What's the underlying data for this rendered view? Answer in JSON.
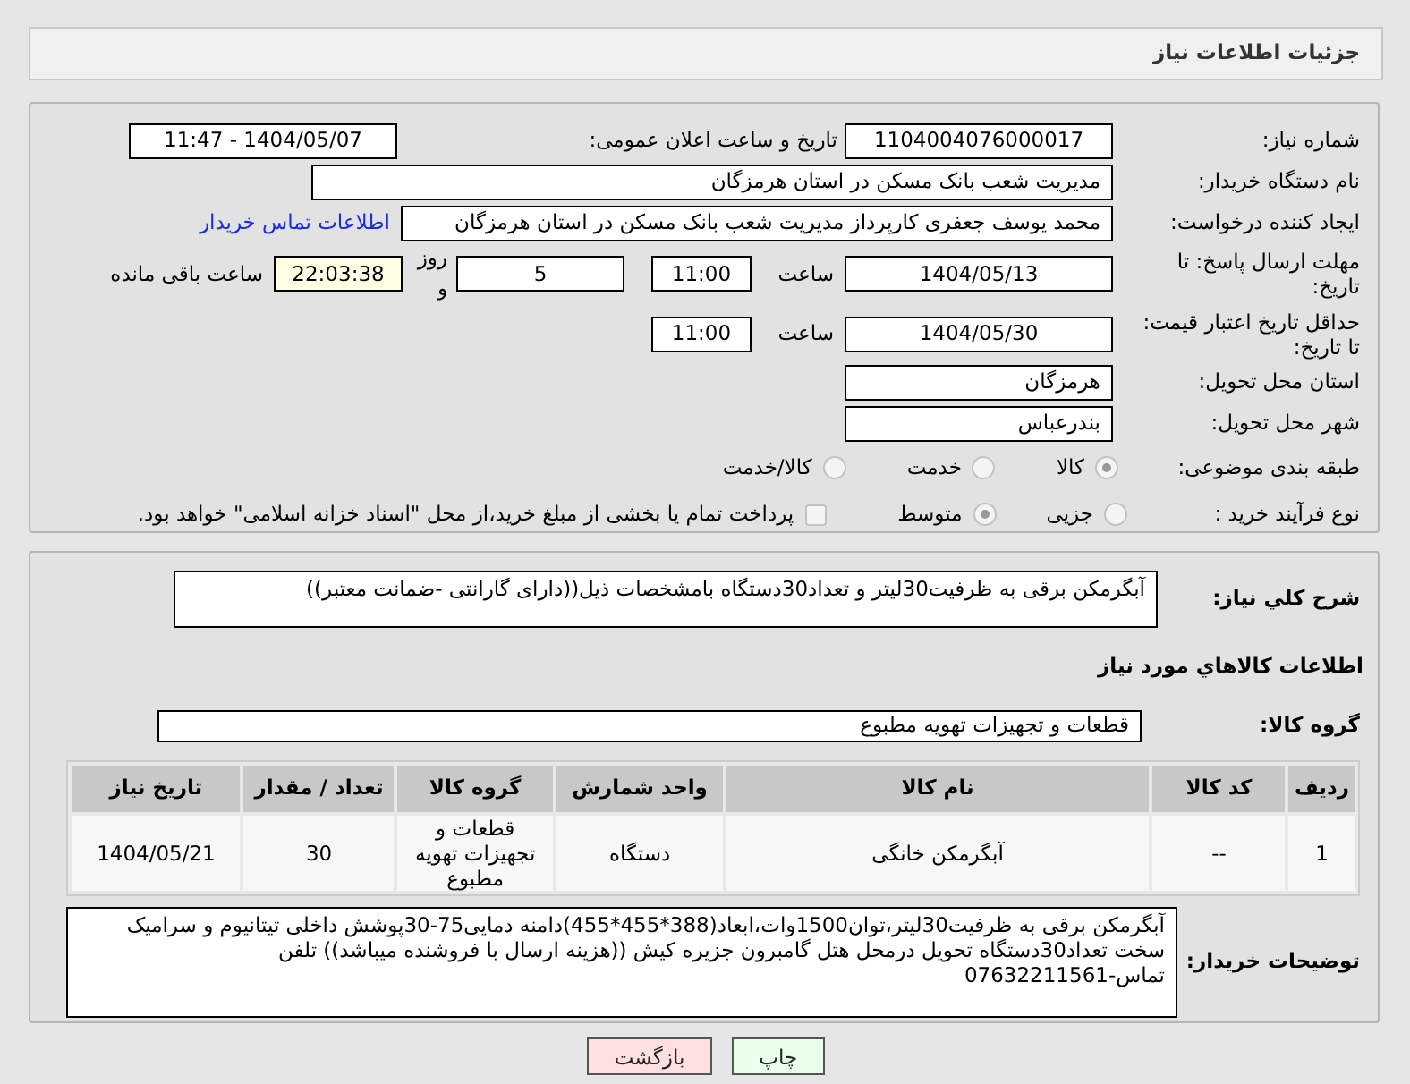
{
  "header": {
    "title": "جزئیات اطلاعات نیاز"
  },
  "need_number": {
    "label": "شماره نیاز:",
    "value": "1104004076000017"
  },
  "announce": {
    "label": "تاریخ و ساعت اعلان عمومی:",
    "value": "1404/05/07 - 11:47"
  },
  "buyer": {
    "label": "نام دستگاه خریدار:",
    "value": "مدیریت شعب بانک مسکن در استان هرمزگان"
  },
  "requester": {
    "label": "ایجاد کننده درخواست:",
    "value": "محمد  یوسف جعفری کارپرداز مدیریت شعب بانک مسکن در استان هرمزگان",
    "link": "اطلاعات تماس خریدار"
  },
  "reply_deadline": {
    "label": "مهلت ارسال پاسخ: تا تاریخ:",
    "date": "1404/05/13",
    "time_label": "ساعت",
    "time": "11:00",
    "days": "5",
    "days_label": "روز و",
    "remaining": "22:03:38",
    "remaining_label": "ساعت باقی مانده"
  },
  "price_validity": {
    "label": "حداقل تاریخ اعتبار قیمت: تا تاریخ:",
    "date": "1404/05/30",
    "time_label": "ساعت",
    "time": "11:00"
  },
  "province": {
    "label": "استان محل تحویل:",
    "value": "هرمزگان"
  },
  "city": {
    "label": "شهر محل تحویل:",
    "value": "بندرعباس"
  },
  "category": {
    "label": "طبقه بندی موضوعی:",
    "options": [
      {
        "label": "کالا",
        "selected": true
      },
      {
        "label": "خدمت",
        "selected": false
      },
      {
        "label": "کالا/خدمت",
        "selected": false
      }
    ]
  },
  "process": {
    "label": "نوع فرآیند خرید :",
    "options": [
      {
        "label": "جزیی",
        "selected": false
      },
      {
        "label": "متوسط",
        "selected": true
      }
    ],
    "payment": {
      "label": "پرداخت تمام یا بخشی از مبلغ خرید،از محل \"اسناد خزانه اسلامی\" خواهد بود.",
      "checked": false
    }
  },
  "description": {
    "label": "شرح کلي نياز:",
    "value": "آبگرمکن برقی به ظرفیت30لیتر و تعداد30دستگاه بامشخصات ذیل((دارای گارانتی -ضمانت معتبر))"
  },
  "goods_title": "اطلاعات کالاهاي مورد نياز",
  "goods_group": {
    "label": "گروه کالا:",
    "value": "قطعات و تجهیزات تهویه مطبوع"
  },
  "table": {
    "columns": [
      "ردیف",
      "کد کالا",
      "نام کالا",
      "واحد شمارش",
      "گروه کالا",
      "تعداد / مقدار",
      "تاریخ نیاز"
    ],
    "rows": [
      [
        "1",
        "--",
        "آبگرمکن خانگی",
        "دستگاه",
        "قطعات و تجهیزات تهویه مطبوع",
        "30",
        "1404/05/21"
      ]
    ]
  },
  "buyer_notes": {
    "label": "توضیحات خریدار:",
    "value": "آبگرمکن برقی به ظرفیت30لیتر،توان1500وات،ابعاد(388*455*455)دامنه دمایی75-30پوشش داخلی تیتانیوم و سرامیک سخت تعداد30دستگاه تحویل درمحل هتل گامبرون جزیره کیش ((هزینه ارسال با فروشنده میباشد)) تلفن تماس-07632211561"
  },
  "buttons": [
    {
      "label": "چاپ",
      "kind": "print"
    },
    {
      "label": "بازگشت",
      "kind": "back"
    }
  ]
}
